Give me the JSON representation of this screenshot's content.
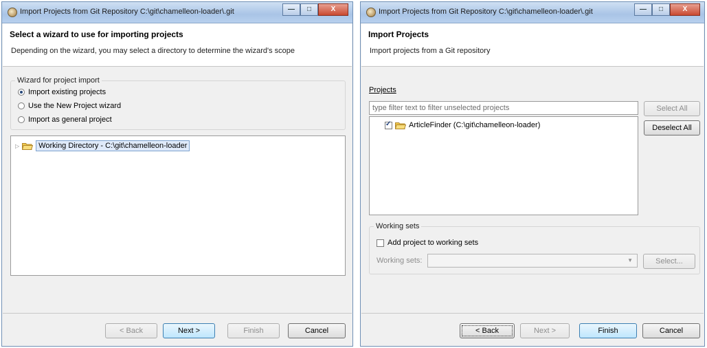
{
  "left": {
    "title": "Import Projects from Git Repository C:\\git\\chamelleon-loader\\.git",
    "header_title": "Select a wizard to use for importing projects",
    "header_desc": "Depending on the wizard, you may select a directory to determine the wizard's scope",
    "group_legend": "Wizard for project import",
    "radios": [
      {
        "label": "Import existing projects",
        "selected": true
      },
      {
        "label": "Use the New Project wizard",
        "selected": false
      },
      {
        "label": "Import as general project",
        "selected": false
      }
    ],
    "tree_item": "Working Directory - C:\\git\\chamelleon-loader",
    "buttons": {
      "back": "< Back",
      "next": "Next >",
      "finish": "Finish",
      "cancel": "Cancel"
    }
  },
  "right": {
    "title": "Import Projects from Git Repository C:\\git\\chamelleon-loader\\.git",
    "header_title": "Import Projects",
    "header_desc": "Import projects from a Git repository",
    "projects_label": "Projects",
    "filter_placeholder": "type filter text to filter unselected projects",
    "select_all": "Select All",
    "deselect_all": "Deselect All",
    "project_item": "ArticleFinder (C:\\git\\chamelleon-loader)",
    "working_sets_legend": "Working sets",
    "add_to_ws": "Add project to working sets",
    "ws_label": "Working sets:",
    "select_btn": "Select...",
    "buttons": {
      "back": "< Back",
      "next": "Next >",
      "finish": "Finish",
      "cancel": "Cancel"
    }
  },
  "window_controls": {
    "minimize": "—",
    "maximize": "□",
    "close": "X"
  },
  "colors": {
    "titlebar": "#a9c4e6",
    "close": "#c94a31",
    "default_button": "#bee6fd"
  }
}
